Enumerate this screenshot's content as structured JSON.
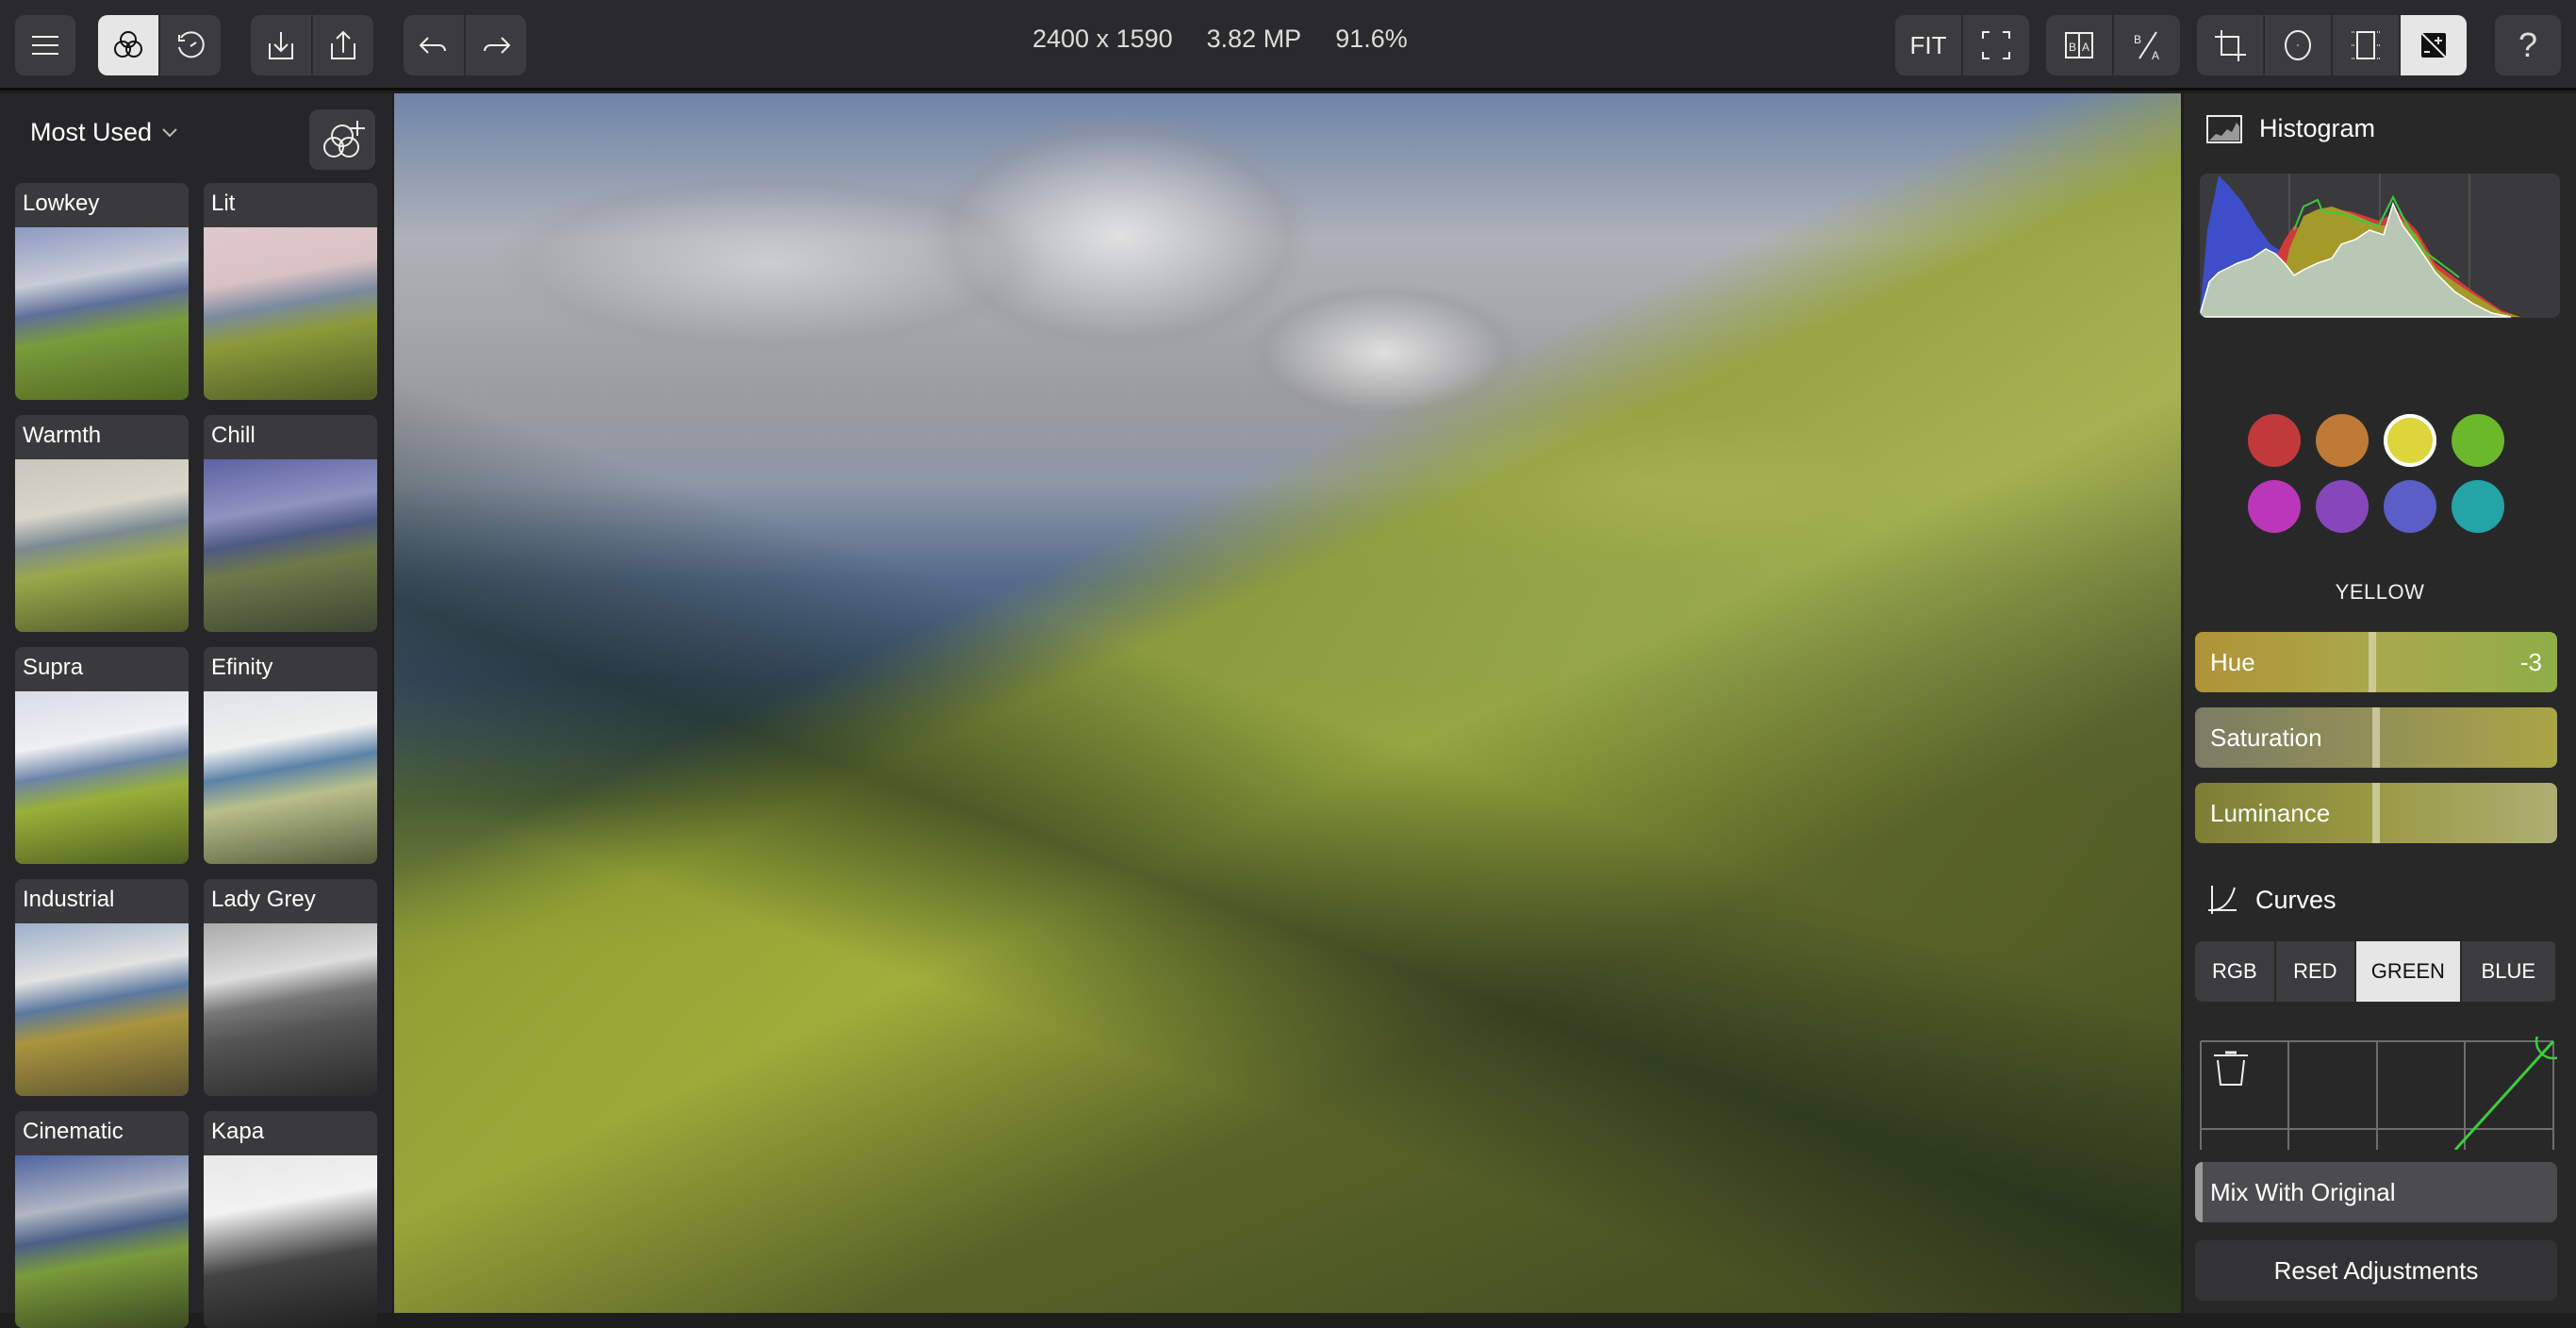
{
  "toolbar": {
    "left_buttons": [
      {
        "name": "menu",
        "icon": "hamburger-icon"
      },
      {
        "name": "filters",
        "icon": "filters-icon",
        "active": true
      },
      {
        "name": "history",
        "icon": "history-icon"
      },
      {
        "name": "import",
        "icon": "import-icon"
      },
      {
        "name": "export",
        "icon": "share-icon"
      },
      {
        "name": "undo",
        "icon": "undo-icon"
      },
      {
        "name": "redo",
        "icon": "redo-icon"
      }
    ],
    "image_dimensions": "2400 x 1590",
    "megapixels": "3.82 MP",
    "zoom_level": "91.6%",
    "fit_label": "FIT",
    "right_buttons": [
      {
        "name": "fit",
        "label": "FIT"
      },
      {
        "name": "fullscreen",
        "icon": "fullscreen-icon"
      },
      {
        "name": "split-compare",
        "icon": "before-after-split-icon"
      },
      {
        "name": "toggle-compare",
        "icon": "before-after-toggle-icon"
      },
      {
        "name": "crop",
        "icon": "crop-icon"
      },
      {
        "name": "vignette",
        "icon": "vignette-icon"
      },
      {
        "name": "frame",
        "icon": "frame-icon"
      },
      {
        "name": "adjustments",
        "icon": "exposure-icon",
        "active": true
      },
      {
        "name": "help",
        "icon": "help-icon"
      }
    ]
  },
  "presets": {
    "category": "Most Used",
    "items": [
      {
        "name": "Lowkey"
      },
      {
        "name": "Lit"
      },
      {
        "name": "Warmth"
      },
      {
        "name": "Chill"
      },
      {
        "name": "Supra"
      },
      {
        "name": "Efinity"
      },
      {
        "name": "Industrial"
      },
      {
        "name": "Lady Grey"
      },
      {
        "name": "Cinematic"
      },
      {
        "name": "Kapa"
      }
    ]
  },
  "histogram": {
    "title": "Histogram"
  },
  "color_mixer": {
    "swatches": [
      {
        "name": "red",
        "color": "#c13a3a"
      },
      {
        "name": "orange",
        "color": "#bf7a37"
      },
      {
        "name": "yellow",
        "color": "#dcd63b",
        "selected": true
      },
      {
        "name": "green",
        "color": "#6bb82a"
      },
      {
        "name": "magenta",
        "color": "#bb37b9"
      },
      {
        "name": "purple",
        "color": "#8647bb"
      },
      {
        "name": "blue",
        "color": "#5a5ec5"
      },
      {
        "name": "aqua",
        "color": "#23a5a8"
      }
    ],
    "selected_label": "YELLOW",
    "sliders": [
      {
        "label": "Hue",
        "value": "-3",
        "position": 0.49
      },
      {
        "label": "Saturation",
        "value": "",
        "position": 0.5
      },
      {
        "label": "Luminance",
        "value": "",
        "position": 0.5
      }
    ]
  },
  "curves": {
    "title": "Curves",
    "channels": [
      "RGB",
      "RED",
      "GREEN",
      "BLUE"
    ],
    "active_channel": "GREEN"
  },
  "mix_with_original": {
    "label": "Mix With Original",
    "value": 0
  },
  "reset_label": "Reset Adjustments"
}
